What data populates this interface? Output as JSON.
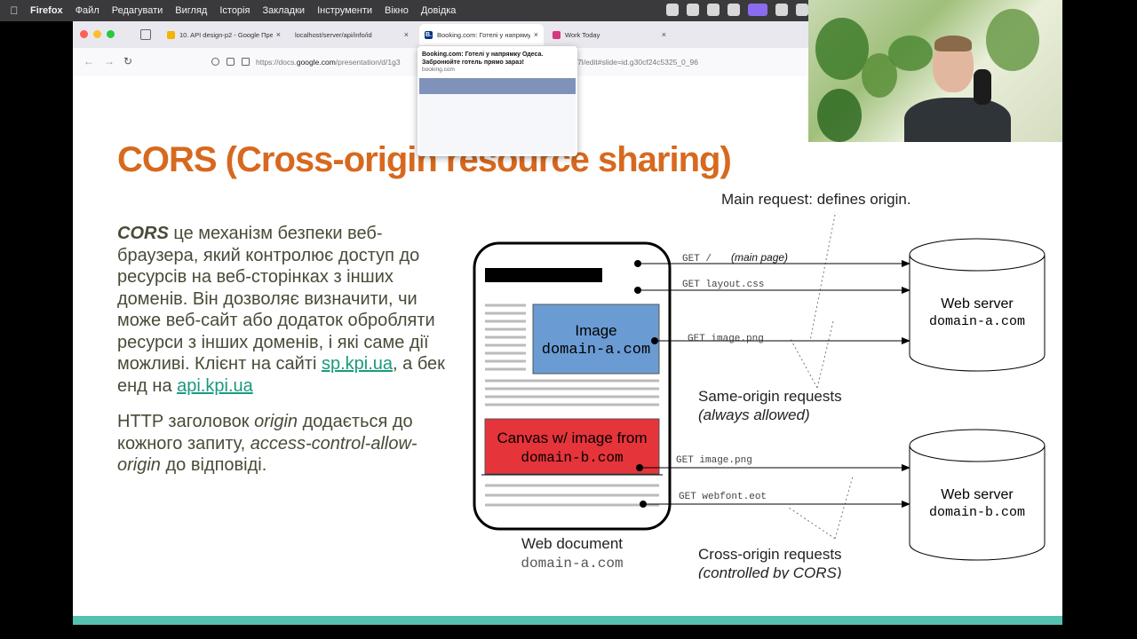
{
  "menubar": {
    "apple_icon": "apple-logo-icon",
    "app_name": "Firefox",
    "items": [
      "Файл",
      "Редагувати",
      "Вигляд",
      "Історія",
      "Закладки",
      "Інструменти",
      "Вікно",
      "Довідка"
    ]
  },
  "browser": {
    "tabs": [
      {
        "title": "10. API design-p2 - Google Пре",
        "favicon_color": "#f4b400"
      },
      {
        "title": "localhost/server/api/info/id",
        "favicon_color": ""
      },
      {
        "title": "Booking.com: Готелі у напряму",
        "favicon_color": "#003580",
        "favicon_text": "B."
      },
      {
        "title": "Work Today",
        "favicon_color": "#d6397f"
      }
    ],
    "tab_close": "×",
    "url_prefix": "https://docs.",
    "url_domain": "google.com",
    "url_rest": "/presentation/d/1g3",
    "url_tail": "bfbV7l/edit#slide=id.g30cf24c5325_0_96",
    "tab_preview": {
      "title": "Booking.com: Готелі у напрямку Одеса. Забронюйте готель прямо зараз!",
      "domain": "booking.com"
    }
  },
  "slide": {
    "title": "CORS (Cross-origin resource sharing)",
    "para1": {
      "term": "CORS",
      "text1": " це механізм безпеки веб-браузера, який контролює доступ до ресурсів на веб-сторінках з інших доменів. Він дозволяє визначити, чи може веб-сайт або додаток обробляти ресурси з інших доменів, і які саме дії можливі. Клієнт на сайті ",
      "link1": "sp.kpi.ua",
      "text2": ", а бек енд на ",
      "link2": "api.kpi.ua"
    },
    "para2": {
      "text1": "HTTP заголовок ",
      "em1": "origin",
      "text2": " додається до кожного запиту, ",
      "em2": "access-control-allow-origin",
      "text3": " до відповіді."
    }
  },
  "diagram": {
    "main_request_label": "Main request: defines origin.",
    "requests": [
      {
        "method": "GET /",
        "note": "(main page)"
      },
      {
        "method": "GET layout.css",
        "note": ""
      },
      {
        "method": "GET image.png",
        "note": ""
      },
      {
        "method": "GET image.png",
        "note": ""
      },
      {
        "method": "GET webfont.eot",
        "note": ""
      }
    ],
    "image_box": {
      "line1": "Image",
      "line2": "domain-a.com",
      "color": "#6a9bd3"
    },
    "canvas_box": {
      "line1": "Canvas w/ image from",
      "line2": "domain-b.com",
      "color": "#e5343a"
    },
    "servers": [
      {
        "name": "Web server",
        "domain": "domain-a.com"
      },
      {
        "name": "Web server",
        "domain": "domain-b.com"
      }
    ],
    "same_origin": {
      "line1": "Same-origin requests",
      "line2": "(always allowed)"
    },
    "cross_origin": {
      "line1": "Cross-origin requests",
      "line2": "(controlled by CORS)"
    },
    "document": {
      "line1": "Web document",
      "line2": "domain-a.com"
    }
  },
  "colors": {
    "title": "#d7691f",
    "body_text": "#4a4a38",
    "link": "#1a9a7c",
    "bottom_bar": "#55c1b1"
  }
}
